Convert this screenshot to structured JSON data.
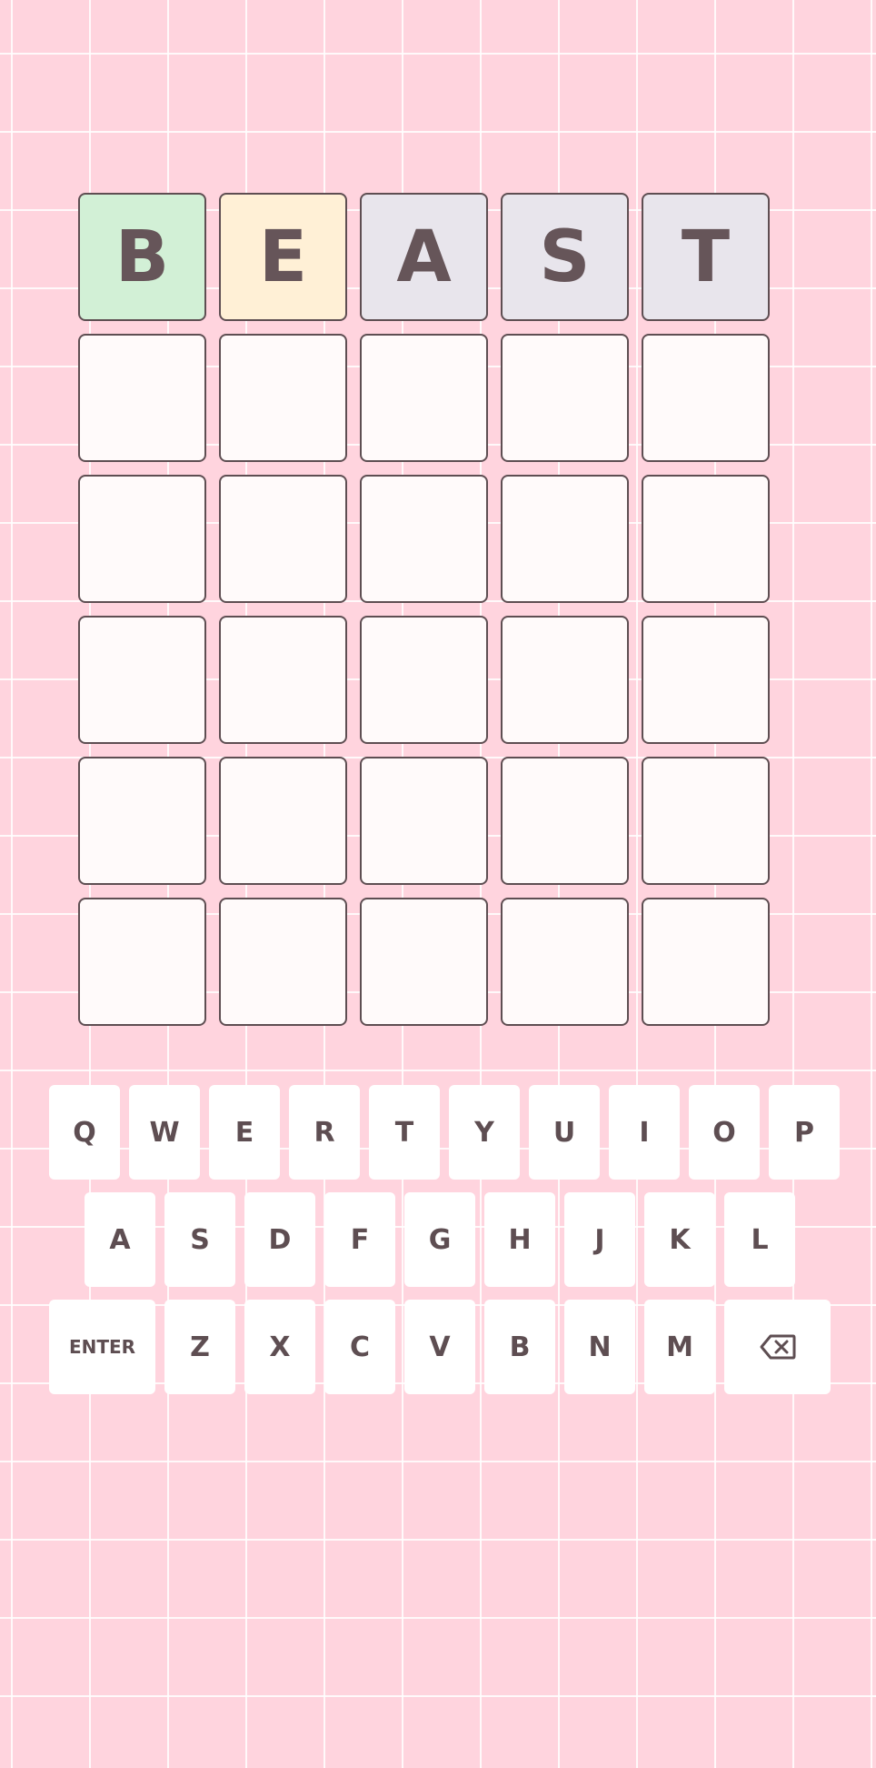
{
  "board": {
    "rows": [
      [
        {
          "letter": "B",
          "state": "correct"
        },
        {
          "letter": "E",
          "state": "present"
        },
        {
          "letter": "A",
          "state": "absent"
        },
        {
          "letter": "S",
          "state": "absent"
        },
        {
          "letter": "T",
          "state": "absent"
        }
      ],
      [
        {
          "letter": ""
        },
        {
          "letter": ""
        },
        {
          "letter": ""
        },
        {
          "letter": ""
        },
        {
          "letter": ""
        }
      ],
      [
        {
          "letter": ""
        },
        {
          "letter": ""
        },
        {
          "letter": ""
        },
        {
          "letter": ""
        },
        {
          "letter": ""
        }
      ],
      [
        {
          "letter": ""
        },
        {
          "letter": ""
        },
        {
          "letter": ""
        },
        {
          "letter": ""
        },
        {
          "letter": ""
        }
      ],
      [
        {
          "letter": ""
        },
        {
          "letter": ""
        },
        {
          "letter": ""
        },
        {
          "letter": ""
        },
        {
          "letter": ""
        }
      ],
      [
        {
          "letter": ""
        },
        {
          "letter": ""
        },
        {
          "letter": ""
        },
        {
          "letter": ""
        },
        {
          "letter": ""
        }
      ]
    ]
  },
  "keyboard": {
    "row1": [
      "Q",
      "W",
      "E",
      "R",
      "T",
      "Y",
      "U",
      "I",
      "O",
      "P"
    ],
    "row2": [
      "A",
      "S",
      "D",
      "F",
      "G",
      "H",
      "J",
      "K",
      "L"
    ],
    "row3": [
      "Z",
      "X",
      "C",
      "V",
      "B",
      "N",
      "M"
    ],
    "enter_label": "ENTER",
    "backspace_icon": "backspace-icon"
  },
  "colors": {
    "background": "#ffd4de",
    "tile_correct": "#d2f0d6",
    "tile_present": "#fff0d6",
    "tile_absent": "#e8e5ec",
    "tile_empty": "#fffafa",
    "text": "#665559"
  }
}
